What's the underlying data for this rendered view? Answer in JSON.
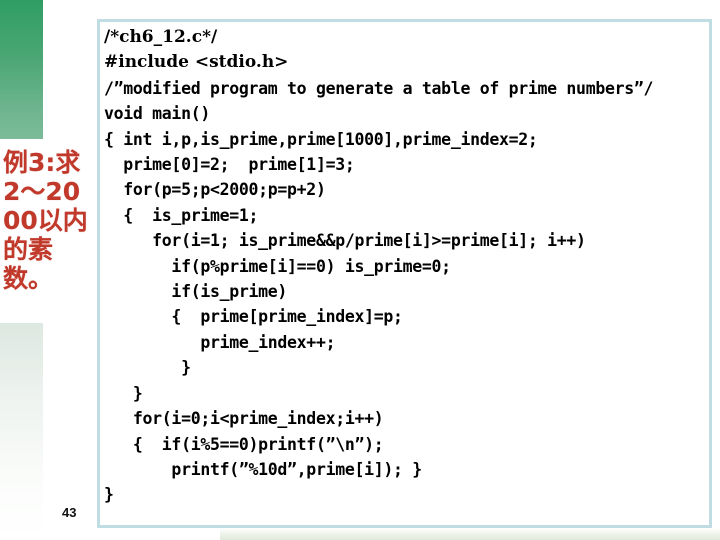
{
  "slide": {
    "page_number": "43",
    "caption_text": "例3:求2～2000以内的素数。",
    "accent_green": "#2f9e63",
    "caption_color": "#c0392b",
    "code_border_color": "#bfdde3"
  },
  "code": {
    "lines": [
      {
        "text": "/*ch6_12.c*/",
        "style": "serif"
      },
      {
        "text": "#include <stdio.h>",
        "style": "serif"
      },
      {
        "text": "/”modified program to generate a table of prime numbers”/",
        "style": "mono"
      },
      {
        "text": "void main()",
        "style": "mono"
      },
      {
        "text": "{ int i,p,is_prime,prime[1000],prime_index=2;",
        "style": "mono"
      },
      {
        "text": "  prime[0]=2;  prime[1]=3;",
        "style": "mono"
      },
      {
        "text": "  for(p=5;p<2000;p=p+2)",
        "style": "mono"
      },
      {
        "text": "  {  is_prime=1;",
        "style": "mono"
      },
      {
        "text": "     for(i=1; is_prime&&p/prime[i]>=prime[i]; i++)",
        "style": "mono"
      },
      {
        "text": "       if(p%prime[i]==0) is_prime=0;",
        "style": "mono"
      },
      {
        "text": "       if(is_prime)",
        "style": "mono"
      },
      {
        "text": "       {  prime[prime_index]=p;",
        "style": "mono"
      },
      {
        "text": "          prime_index++;",
        "style": "mono"
      },
      {
        "text": "        }",
        "style": "mono"
      },
      {
        "text": "   }",
        "style": "mono"
      },
      {
        "text": "   for(i=0;i<prime_index;i++)",
        "style": "mono"
      },
      {
        "text": "   {  if(i%5==0)printf(”\\n”);",
        "style": "mono"
      },
      {
        "text": "       printf(”%10d”,prime[i]); }",
        "style": "mono"
      },
      {
        "text": "}",
        "style": "mono"
      }
    ]
  }
}
